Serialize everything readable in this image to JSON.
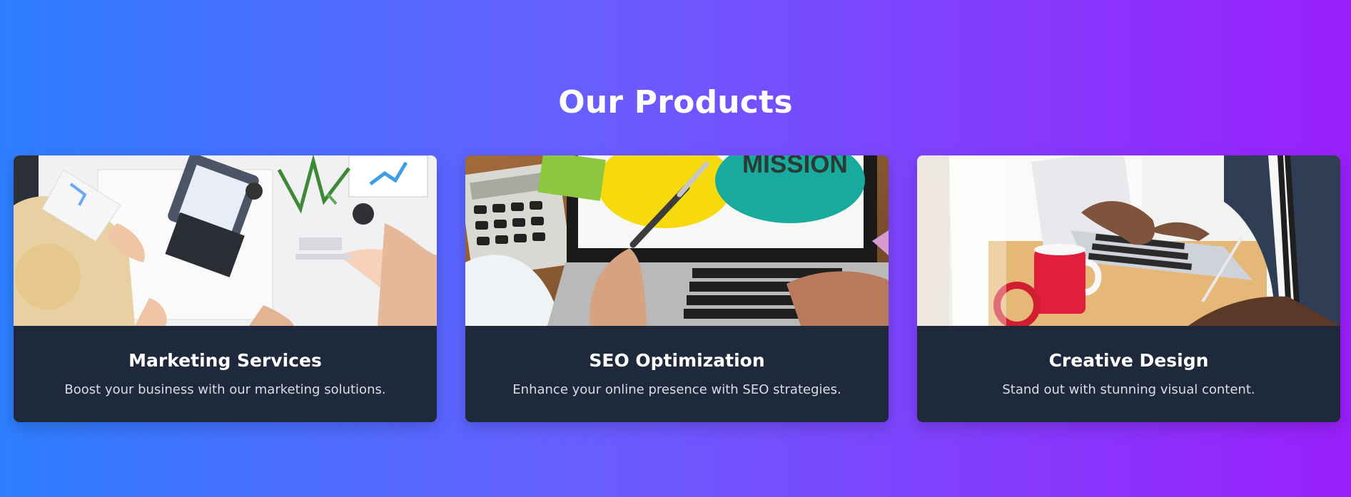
{
  "section": {
    "title": "Our Products"
  },
  "products": [
    {
      "title": "Marketing Services",
      "description": "Boost your business with our marketing solutions.",
      "image_icon": "marketing-team-photo"
    },
    {
      "title": "SEO Optimization",
      "description": "Enhance your online presence with SEO strategies.",
      "image_icon": "laptop-mission-photo",
      "image_text": "MISSION"
    },
    {
      "title": "Creative Design",
      "description": "Stand out with stunning visual content.",
      "image_icon": "designer-laptop-photo"
    }
  ],
  "colors": {
    "background_start": "#2d7eff",
    "background_end": "#9a1ffb",
    "card_background": "#1e293b"
  }
}
